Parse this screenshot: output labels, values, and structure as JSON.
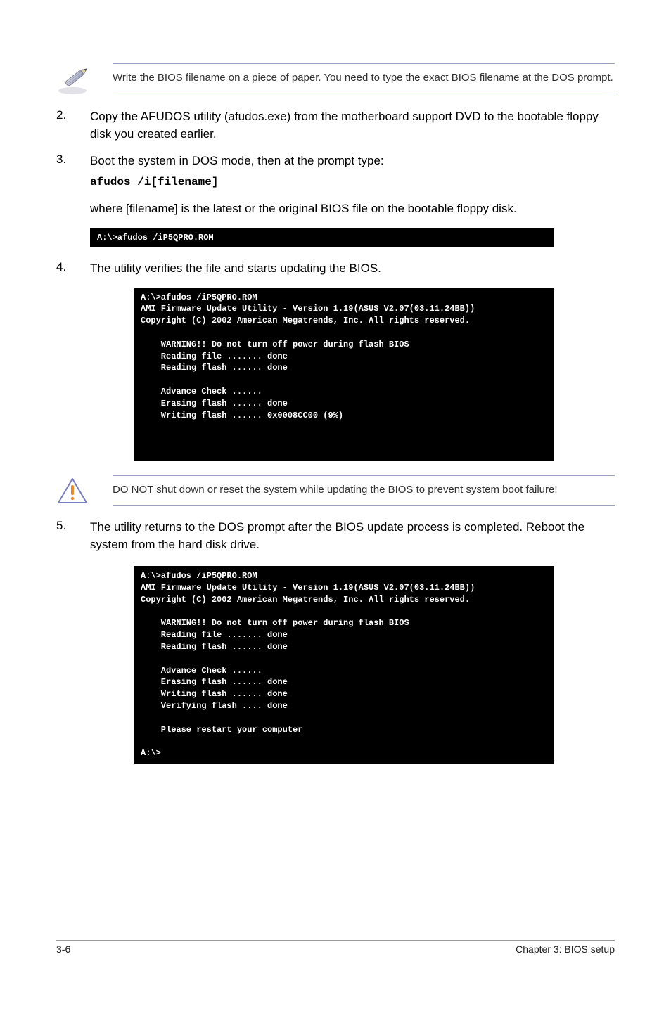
{
  "notes": {
    "pencil": "Write the BIOS filename on a piece of paper. You need to type the exact BIOS filename at the DOS prompt.",
    "warning": "DO NOT shut down or reset the system while updating the BIOS to prevent system boot failure!"
  },
  "steps": {
    "s2": {
      "num": "2.",
      "text": "Copy the AFUDOS utility (afudos.exe) from the motherboard support DVD to the bootable floppy disk you created earlier."
    },
    "s3": {
      "num": "3.",
      "text": "Boot the system in DOS mode, then at the prompt type:",
      "cmd": "afudos /i[filename]",
      "after": "where [filename] is the latest or the original BIOS file on the bootable floppy disk."
    },
    "s4": {
      "num": "4.",
      "text": "The utility verifies the file and starts updating the BIOS."
    },
    "s5": {
      "num": "5.",
      "text": "The utility returns to the DOS prompt after the BIOS update process is completed. Reboot the system from the hard disk drive."
    }
  },
  "terminals": {
    "t1": "A:\\>afudos /iP5QPRO.ROM",
    "t2": "A:\\>afudos /iP5QPRO.ROM\nAMI Firmware Update Utility - Version 1.19(ASUS V2.07(03.11.24BB))\nCopyright (C) 2002 American Megatrends, Inc. All rights reserved.\n\n    WARNING!! Do not turn off power during flash BIOS\n    Reading file ....... done\n    Reading flash ...... done\n\n    Advance Check ......\n    Erasing flash ...... done\n    Writing flash ...... 0x0008CC00 (9%)\n\n\n\n",
    "t3": "A:\\>afudos /iP5QPRO.ROM\nAMI Firmware Update Utility - Version 1.19(ASUS V2.07(03.11.24BB))\nCopyright (C) 2002 American Megatrends, Inc. All rights reserved.\n\n    WARNING!! Do not turn off power during flash BIOS\n    Reading file ....... done\n    Reading flash ...... done\n\n    Advance Check ......\n    Erasing flash ...... done\n    Writing flash ...... done\n    Verifying flash .... done\n\n    Please restart your computer\n\nA:\\>"
  },
  "footer": {
    "left": "3-6",
    "right": "Chapter 3: BIOS setup"
  }
}
